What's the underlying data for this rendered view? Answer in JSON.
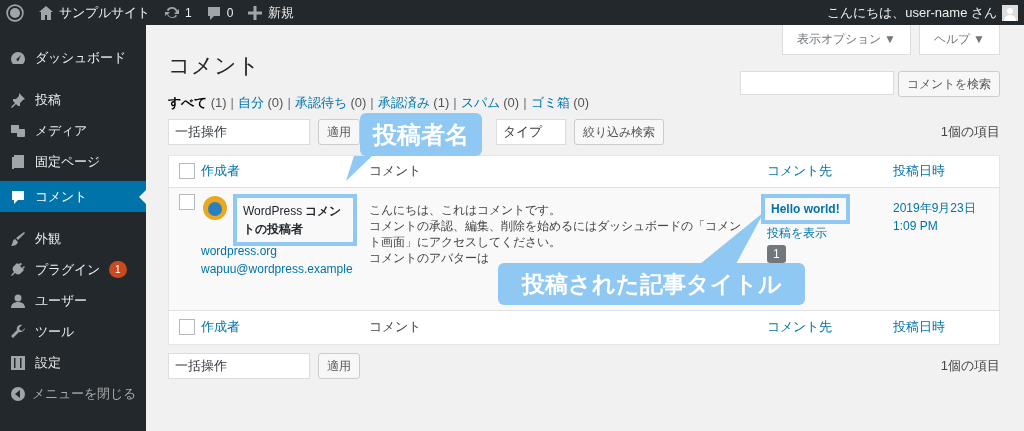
{
  "admin_bar": {
    "items": [
      {
        "kind": "logo"
      },
      {
        "kind": "site",
        "label": "サンプルサイト"
      },
      {
        "kind": "updates",
        "label": "1"
      },
      {
        "kind": "comments",
        "label": "0"
      },
      {
        "kind": "new",
        "label": "新規"
      }
    ],
    "greeting": "こんにちは、user-name さん"
  },
  "sidebar": {
    "items": [
      {
        "label": "ダッシュボード",
        "selected": false
      },
      {
        "label": "投稿",
        "selected": false
      },
      {
        "label": "メディア",
        "selected": false
      },
      {
        "label": "固定ページ",
        "selected": false
      },
      {
        "label": "コメント",
        "selected": true
      },
      {
        "label": "外観",
        "selected": false
      },
      {
        "label": "プラグイン",
        "selected": false,
        "badge": "1"
      },
      {
        "label": "ユーザー",
        "selected": false
      },
      {
        "label": "ツール",
        "selected": false
      },
      {
        "label": "設定",
        "selected": false
      }
    ],
    "collapse": "メニューを閉じる"
  },
  "screen_tabs": [
    "表示オプション ▼",
    "ヘルプ ▼"
  ],
  "page_title": "コメント",
  "filters": {
    "separator": "|",
    "items": [
      {
        "label": "すべて",
        "count": "(1)",
        "selected": true
      },
      {
        "label": "自分",
        "count": "(0)",
        "selected": false
      },
      {
        "label": "承認待ち",
        "count": "(0)",
        "selected": false
      },
      {
        "label": "承認済み",
        "count": "(1)",
        "selected": false
      },
      {
        "label": "スパム",
        "count": "(0)",
        "selected": false
      },
      {
        "label": "ゴミ箱",
        "count": "(0)",
        "selected": false
      }
    ]
  },
  "search": {
    "button": "コメントを検索"
  },
  "top_actions": {
    "bulk": "一括操作",
    "apply": "適用",
    "type": "タイプ",
    "filter": "絞り込み検索",
    "count": "1個の項目"
  },
  "table": {
    "header_checked": false,
    "columns": [
      "作成者",
      "コメント",
      "コメント先",
      "投稿日時"
    ],
    "rows": [
      {
        "checked": false,
        "author": "WordPress **コメントの投稿者**",
        "author_url": "wordpress.org",
        "author_email": "wapuu@wordpress.example",
        "comment": [
          "こんにちは、これはコメントです。",
          "コメントの承認、編集、削除を始めるにはダッシュボードの「コメント画面」にアクセスしてください。",
          "コメントのアバターは"
        ],
        "response": "Hello world!",
        "response_action": "投稿を表示",
        "response_count": "1",
        "date": "2019年9月23日",
        "time": "1:09 PM"
      }
    ],
    "footer_checked": false,
    "footer_columns": [
      "作成者",
      "コメント",
      "コメント先",
      "投稿日時"
    ]
  },
  "bottom_actions": {
    "bulk": "一括操作",
    "apply": "適用",
    "count": "1個の項目"
  },
  "callouts": [
    {
      "text": "投稿者名"
    },
    {
      "text": "投稿された記事タイトル"
    }
  ]
}
